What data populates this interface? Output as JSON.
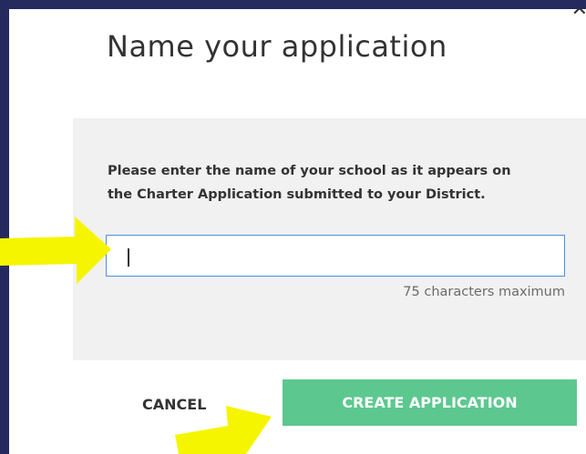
{
  "modal": {
    "title": "Name your application",
    "close_icon": "close-icon"
  },
  "form": {
    "prompt": "Please enter the name of your school as it appears on the Charter Application submitted to your District.",
    "name_input": {
      "value": "",
      "placeholder": ""
    },
    "char_limit": "75 characters maximum"
  },
  "actions": {
    "cancel_label": "CANCEL",
    "create_label": "CREATE APPLICATION"
  },
  "colors": {
    "backdrop": "#252a5e",
    "create_button": "#5cc88f",
    "input_border": "#4d8fe0",
    "annotation_arrow": "#f5f500"
  }
}
